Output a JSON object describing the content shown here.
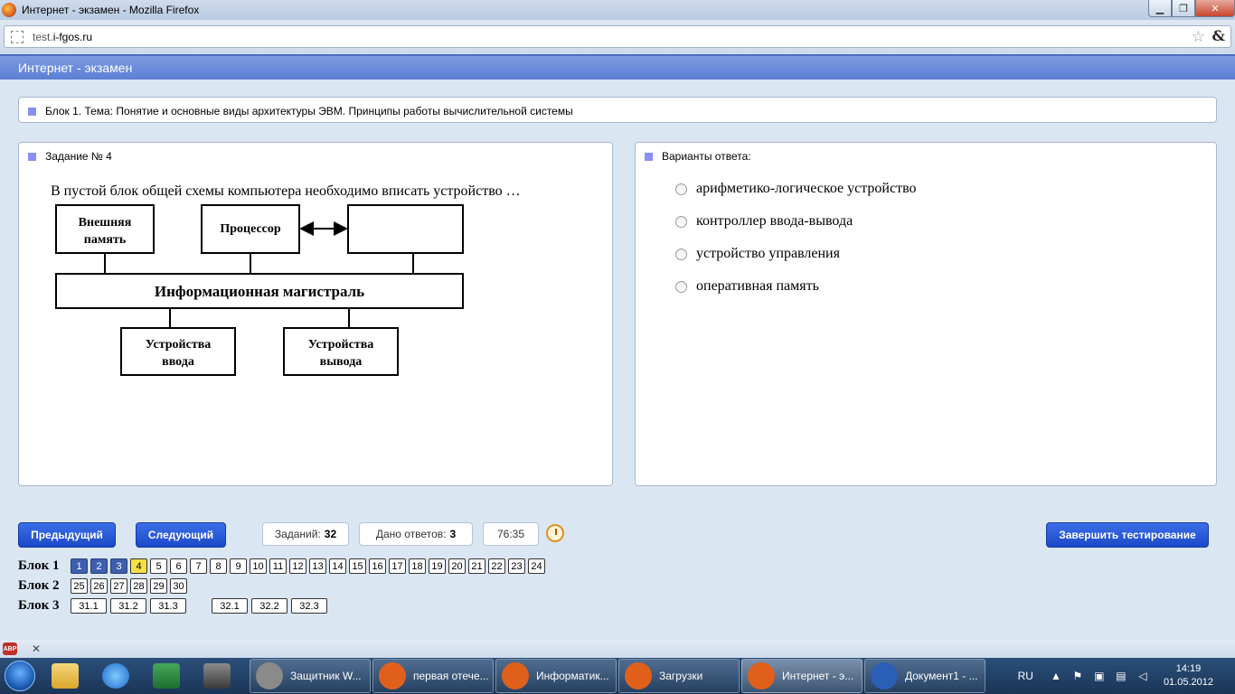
{
  "window": {
    "title": "Интернет - экзамен - Mozilla Firefox",
    "minimize": "▁",
    "maximize": "❐",
    "close": "✕"
  },
  "browser": {
    "url_prefix": "test.",
    "url_domain": "i-fgos.ru",
    "bookmark_star": "☆",
    "addon_glyph": "&"
  },
  "page": {
    "header": "Интернет - экзамен",
    "topic": "Блок 1. Тема: Понятие и основные виды архитектуры ЭВМ. Принципы работы вычислительной системы",
    "question_label": "Задание № 4",
    "question_text": "В пустой блок общей схемы компьютера необходимо вписать устройство …",
    "answers_label": "Варианты ответа:",
    "diagram": {
      "external_memory": [
        "Внешняя",
        "память"
      ],
      "processor": "Процессор",
      "bus": "Информационная магистраль",
      "input_devices": [
        "Устройства",
        "ввода"
      ],
      "output_devices": [
        "Устройства",
        "вывода"
      ]
    },
    "options": [
      "арифметико-логическое устройство",
      "контроллер ввода-вывода",
      "устройство управления",
      "оперативная память"
    ]
  },
  "controls": {
    "prev_label": "Предыдущий",
    "next_label": "Следующий",
    "tasks_label": "Заданий:",
    "tasks_count": "32",
    "answered_label": "Дано ответов:",
    "answered_count": "3",
    "timer": "76:35",
    "finish_label": "Завершить тестирование"
  },
  "blocks": {
    "block1_label": "Блок 1",
    "block1": [
      "1",
      "2",
      "3",
      "4",
      "5",
      "6",
      "7",
      "8",
      "9",
      "10",
      "11",
      "12",
      "13",
      "14",
      "15",
      "16",
      "17",
      "18",
      "19",
      "20",
      "21",
      "22",
      "23",
      "24"
    ],
    "block1_answered": [
      1,
      2,
      3
    ],
    "block1_current": 4,
    "block2_label": "Блок 2",
    "block2": [
      "25",
      "26",
      "27",
      "28",
      "29",
      "30"
    ],
    "block3_label": "Блок 3",
    "block3a": [
      "31.1",
      "31.2",
      "31.3"
    ],
    "block3b": [
      "32.1",
      "32.2",
      "32.3"
    ]
  },
  "abp": {
    "label": "ABP",
    "close": "✕"
  },
  "taskbar": {
    "tasks": [
      {
        "label": "Защитник W...",
        "color": "#8a8a8a"
      },
      {
        "label": "первая отечe...",
        "color": "#e0601b"
      },
      {
        "label": "Информатик...",
        "color": "#e0601b"
      },
      {
        "label": "Загрузки",
        "color": "#e0601b"
      },
      {
        "label": "Интернет - э...",
        "color": "#e0601b"
      },
      {
        "label": "Документ1 - ...",
        "color": "#2b5fb5"
      }
    ],
    "lang": "RU",
    "time": "14:19",
    "date": "01.05.2012"
  }
}
